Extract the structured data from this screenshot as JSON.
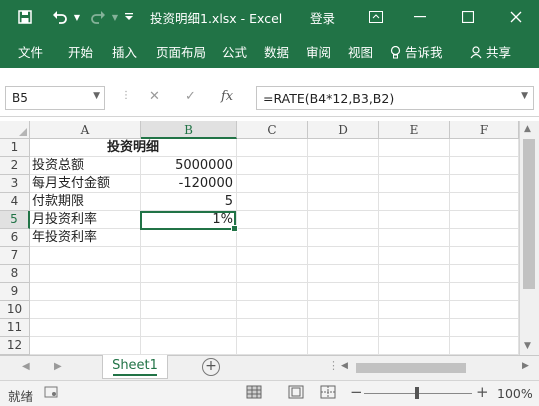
{
  "titlebar": {
    "title": "投资明细1.xlsx  -  Excel",
    "login": "登录",
    "save_icon": "save-icon",
    "undo_icon": "undo-icon",
    "redo_icon": "redo-icon",
    "customize_icon": "customize-qat-icon"
  },
  "ribbon": {
    "tabs": [
      "文件",
      "开始",
      "插入",
      "页面布局",
      "公式",
      "数据",
      "审阅",
      "视图"
    ],
    "tell_me": "告诉我",
    "share": "共享"
  },
  "formula_bar": {
    "name_box": "B5",
    "formula": "=RATE(B4*12,B3,B2)",
    "fx_label": "fx"
  },
  "sheet": {
    "columns": [
      "A",
      "B",
      "C",
      "D",
      "E",
      "F"
    ],
    "rows": [
      "1",
      "2",
      "3",
      "4",
      "5",
      "6",
      "7",
      "8",
      "9",
      "10",
      "11",
      "12"
    ],
    "cells": {
      "A1": "投资明细",
      "A2": "投资总额",
      "B2": "5000000",
      "A3": "每月支付金额",
      "B3": "-120000",
      "A4": "付款期限",
      "B4": "5",
      "A5": "月投资利率",
      "B5": "1%",
      "A6": "年投资利率"
    },
    "selected_cell": "B5",
    "accent_color": "#217346"
  },
  "tabs_bar": {
    "sheet_name": "Sheet1",
    "add_sheet": "+"
  },
  "status": {
    "ready": "就绪",
    "zoom": "100%"
  }
}
